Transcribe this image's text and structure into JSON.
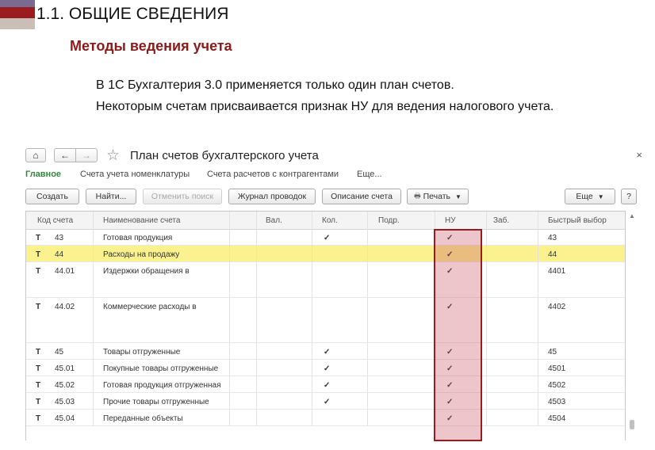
{
  "slide": {
    "title": "1.1. ОБЩИЕ СВЕДЕНИЯ",
    "subtitle": "Методы ведения учета",
    "body": [
      "В 1С Бухгалтерия 3.0 применяется только один план счетов.",
      "Некоторым счетам присваивается признак НУ для ведения налогового учета."
    ],
    "colors": {
      "subtitle": "#8b1a1a",
      "highlight_border": "#9b1a1f",
      "highlight_fill": "#c44d5e"
    }
  },
  "window": {
    "title": "План счетов бухгалтерского учета",
    "close_label": "×",
    "nav": {
      "home": "⌂",
      "back": "←",
      "forward": "→",
      "favorite": "☆"
    },
    "tabs": [
      {
        "label": "Главное",
        "active": true
      },
      {
        "label": "Счета учета номенклатуры",
        "active": false
      },
      {
        "label": "Счета расчетов с контрагентами",
        "active": false
      },
      {
        "label": "Еще...",
        "active": false
      }
    ],
    "toolbar": {
      "create": "Создать",
      "find": "Найти...",
      "cancel_search": "Отменить поиск",
      "journal": "Журнал проводок",
      "account_info": "Описание счета",
      "print": "Печать",
      "more": "Еще",
      "help": "?"
    },
    "columns": {
      "code": "Код счета",
      "name": "Наименование счета",
      "currency": "Вал.",
      "quantity": "Кол.",
      "subdivision": "Подр.",
      "tax": "НУ",
      "off_balance": "Заб.",
      "quick": "Быстрый выбор"
    },
    "check_glyph": "✓",
    "type_icon": "T",
    "rows": [
      {
        "code": "43",
        "name": "Готовая продукция",
        "qty": true,
        "nu": true,
        "quick": "43",
        "selected": false
      },
      {
        "code": "44",
        "name": "Расходы на продажу",
        "qty": false,
        "nu": true,
        "quick": "44",
        "selected": true
      },
      {
        "code": "44.01",
        "name": "Издержки обращения в",
        "qty": false,
        "nu": true,
        "quick": "4401",
        "selected": false
      },
      {
        "code": "44.02",
        "name": "Коммерческие расходы в",
        "qty": false,
        "nu": true,
        "quick": "4402",
        "selected": false
      },
      {
        "code": "45",
        "name": "Товары отгруженные",
        "qty": true,
        "nu": true,
        "quick": "45",
        "selected": false
      },
      {
        "code": "45.01",
        "name": "Покупные товары отгруженные",
        "qty": true,
        "nu": true,
        "quick": "4501",
        "selected": false
      },
      {
        "code": "45.02",
        "name": "Готовая продукция отгруженная",
        "qty": true,
        "nu": true,
        "quick": "4502",
        "selected": false
      },
      {
        "code": "45.03",
        "name": "Прочие товары отгруженные",
        "qty": true,
        "nu": true,
        "quick": "4503",
        "selected": false
      },
      {
        "code": "45.04",
        "name": "Переданные объекты",
        "qty": false,
        "nu": true,
        "quick": "4504",
        "selected": false
      }
    ]
  }
}
